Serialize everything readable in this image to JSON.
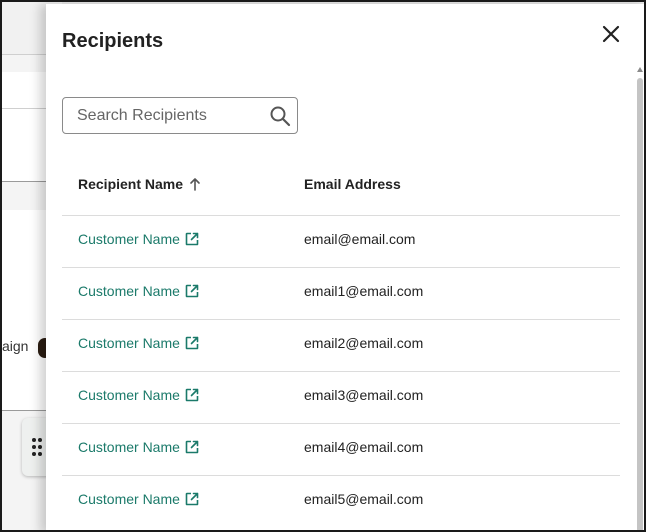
{
  "background": {
    "partial_text": "aign"
  },
  "drawer": {
    "title": "Recipients",
    "search": {
      "placeholder": "Search Recipients",
      "value": ""
    },
    "columns": {
      "name_label": "Recipient Name",
      "email_label": "Email Address",
      "sort": "ascending"
    },
    "rows": [
      {
        "name": "Customer Name",
        "email": "email@email.com"
      },
      {
        "name": "Customer Name",
        "email": "email1@email.com"
      },
      {
        "name": "Customer Name",
        "email": "email2@email.com"
      },
      {
        "name": "Customer Name",
        "email": "email3@email.com"
      },
      {
        "name": "Customer Name",
        "email": "email4@email.com"
      },
      {
        "name": "Customer Name",
        "email": "email5@email.com"
      }
    ]
  },
  "colors": {
    "link": "#1b7a6a",
    "text": "#222222",
    "divider": "#dcdcdc"
  }
}
